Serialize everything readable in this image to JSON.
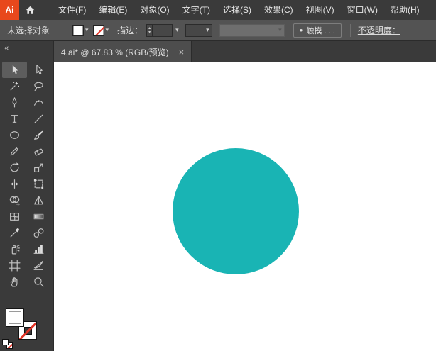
{
  "app": {
    "logo_text": "Ai",
    "menu_items": [
      "文件(F)",
      "编辑(E)",
      "对象(O)",
      "文字(T)",
      "选择(S)",
      "效果(C)",
      "视图(V)",
      "窗口(W)",
      "帮助(H)"
    ]
  },
  "control_bar": {
    "selection_status": "未选择对象",
    "stroke_label": "描边：",
    "touch_bullet": "●",
    "touch_button": "触摸 . . .",
    "opacity_label": "不透明度："
  },
  "document_tab": {
    "title": "4.ai* @ 67.83 % (RGB/预览)",
    "close_glyph": "×"
  },
  "tool_panel": {
    "collapse_glyph": "«",
    "tools": [
      {
        "name": "selection-tool",
        "icon": "selection",
        "active": true
      },
      {
        "name": "direct-selection-tool",
        "icon": "direct-selection",
        "active": false
      },
      {
        "name": "magic-wand-tool",
        "icon": "magic-wand",
        "active": false
      },
      {
        "name": "lasso-tool",
        "icon": "lasso",
        "active": false
      },
      {
        "name": "pen-tool",
        "icon": "pen",
        "active": false
      },
      {
        "name": "curvature-tool",
        "icon": "curvature",
        "active": false
      },
      {
        "name": "type-tool",
        "icon": "type",
        "active": false
      },
      {
        "name": "line-segment-tool",
        "icon": "line-segment",
        "active": false
      },
      {
        "name": "ellipse-tool",
        "icon": "ellipse",
        "active": false
      },
      {
        "name": "paintbrush-tool",
        "icon": "paintbrush",
        "active": false
      },
      {
        "name": "pencil-tool",
        "icon": "pencil",
        "active": false
      },
      {
        "name": "eraser-tool",
        "icon": "eraser",
        "active": false
      },
      {
        "name": "rotate-tool",
        "icon": "rotate",
        "active": false
      },
      {
        "name": "scale-tool",
        "icon": "scale",
        "active": false
      },
      {
        "name": "width-tool",
        "icon": "width",
        "active": false
      },
      {
        "name": "free-transform-tool",
        "icon": "free-transform",
        "active": false
      },
      {
        "name": "shape-builder-tool",
        "icon": "shape-builder",
        "active": false
      },
      {
        "name": "perspective-grid-tool",
        "icon": "perspective-grid",
        "active": false
      },
      {
        "name": "mesh-tool",
        "icon": "mesh",
        "active": false
      },
      {
        "name": "gradient-tool",
        "icon": "gradient",
        "active": false
      },
      {
        "name": "eyedropper-tool",
        "icon": "eyedropper",
        "active": false
      },
      {
        "name": "blend-tool",
        "icon": "blend",
        "active": false
      },
      {
        "name": "symbol-sprayer-tool",
        "icon": "symbol-sprayer",
        "active": false
      },
      {
        "name": "column-graph-tool",
        "icon": "column-graph",
        "active": false
      },
      {
        "name": "artboard-tool",
        "icon": "artboard",
        "active": false
      },
      {
        "name": "slice-tool",
        "icon": "slice",
        "active": false
      },
      {
        "name": "hand-tool",
        "icon": "hand",
        "active": false
      },
      {
        "name": "zoom-tool",
        "icon": "zoom",
        "active": false
      }
    ]
  },
  "canvas": {
    "shape": {
      "type": "ellipse",
      "fill": "#19b4b4"
    }
  },
  "colors": {
    "teal_fill": "#19b4b4",
    "none_slash_red": "#e23326",
    "logo_background": "#e8481c",
    "fill_swatch": "#ffffff",
    "menubar_background": "#3a3a3a",
    "controlbar_background": "#535353"
  }
}
